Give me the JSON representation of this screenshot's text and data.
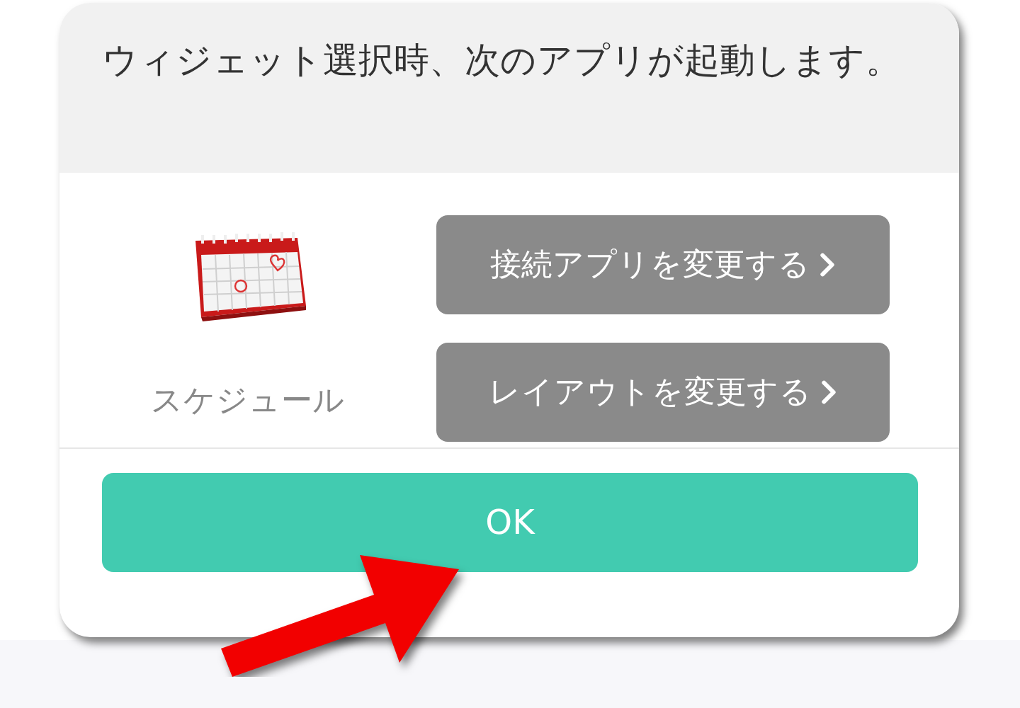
{
  "dialog": {
    "message": "ウィジェット選択時、次のアプリが起動します。",
    "app": {
      "name": "スケジュール"
    },
    "actions": [
      {
        "label": "接続アプリを変更する"
      },
      {
        "label": "レイアウトを変更する"
      }
    ],
    "confirm": "OK"
  }
}
